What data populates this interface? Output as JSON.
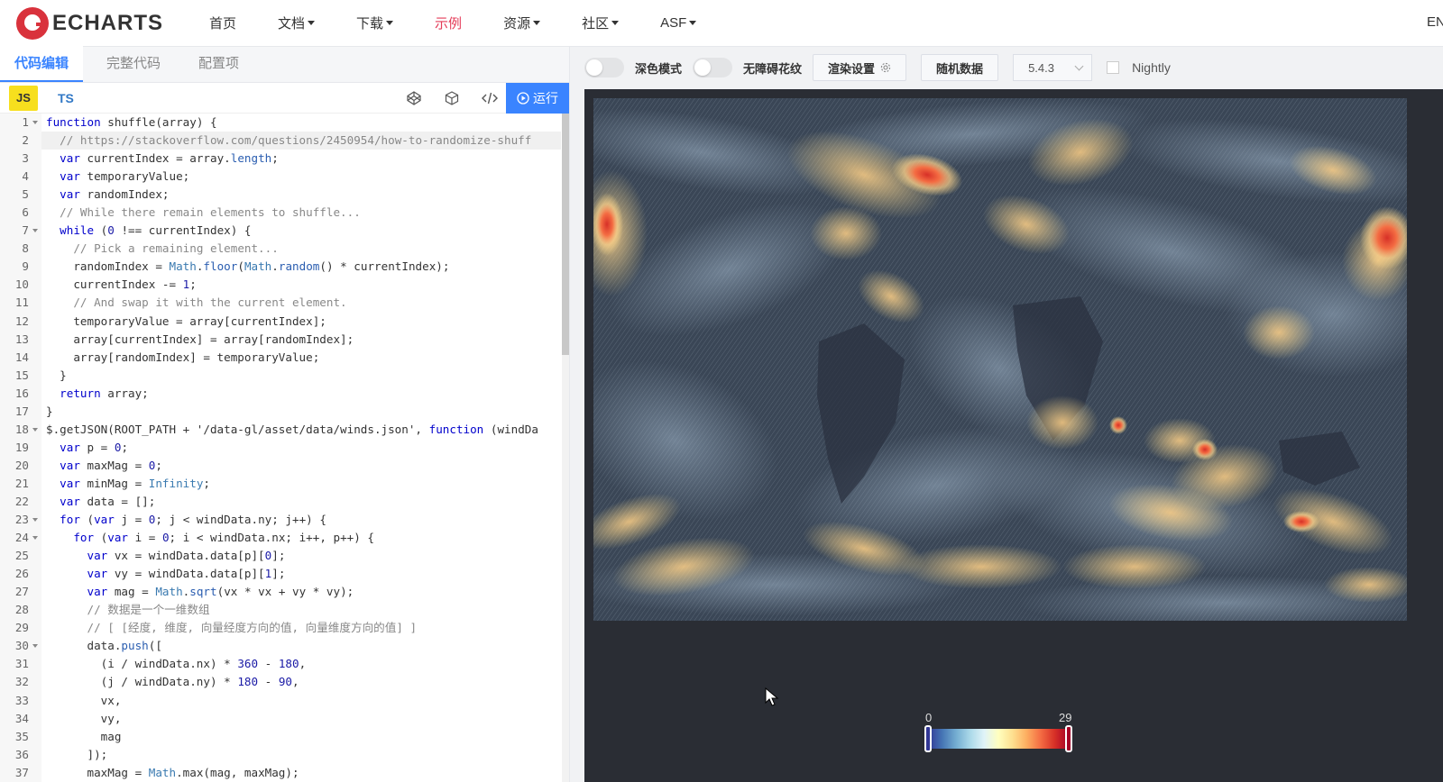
{
  "nav": {
    "logo_text": "ECHARTS",
    "items": [
      {
        "label": "首页",
        "dropdown": false,
        "active": false
      },
      {
        "label": "文档",
        "dropdown": true,
        "active": false
      },
      {
        "label": "下载",
        "dropdown": true,
        "active": false
      },
      {
        "label": "示例",
        "dropdown": false,
        "active": true
      },
      {
        "label": "资源",
        "dropdown": true,
        "active": false
      },
      {
        "label": "社区",
        "dropdown": true,
        "active": false
      },
      {
        "label": "ASF",
        "dropdown": true,
        "active": false
      }
    ],
    "lang": "EN",
    "active_color": "#e43c59"
  },
  "editor": {
    "tabs": [
      "代码编辑",
      "完整代码",
      "配置项"
    ],
    "active_tab": 0,
    "lang_js": "JS",
    "lang_ts": "TS",
    "tool_icons": [
      "codepen-icon",
      "codesandbox-icon",
      "code-icon"
    ],
    "run_label": "运行",
    "accent": "#3a84ff",
    "current_line": 2,
    "lines": [
      {
        "n": "1",
        "fold": true,
        "code": "function shuffle(array) {"
      },
      {
        "n": "2",
        "fold": false,
        "code": "  // https://stackoverflow.com/questions/2450954/how-to-randomize-shuff"
      },
      {
        "n": "3",
        "fold": false,
        "code": "  var currentIndex = array.length;"
      },
      {
        "n": "4",
        "fold": false,
        "code": "  var temporaryValue;"
      },
      {
        "n": "5",
        "fold": false,
        "code": "  var randomIndex;"
      },
      {
        "n": "6",
        "fold": false,
        "code": "  // While there remain elements to shuffle..."
      },
      {
        "n": "7",
        "fold": true,
        "code": "  while (0 !== currentIndex) {"
      },
      {
        "n": "8",
        "fold": false,
        "code": "    // Pick a remaining element..."
      },
      {
        "n": "9",
        "fold": false,
        "code": "    randomIndex = Math.floor(Math.random() * currentIndex);"
      },
      {
        "n": "10",
        "fold": false,
        "code": "    currentIndex -= 1;"
      },
      {
        "n": "11",
        "fold": false,
        "code": "    // And swap it with the current element."
      },
      {
        "n": "12",
        "fold": false,
        "code": "    temporaryValue = array[currentIndex];"
      },
      {
        "n": "13",
        "fold": false,
        "code": "    array[currentIndex] = array[randomIndex];"
      },
      {
        "n": "14",
        "fold": false,
        "code": "    array[randomIndex] = temporaryValue;"
      },
      {
        "n": "15",
        "fold": false,
        "code": "  }"
      },
      {
        "n": "16",
        "fold": false,
        "code": "  return array;"
      },
      {
        "n": "17",
        "fold": false,
        "code": "}"
      },
      {
        "n": "18",
        "fold": true,
        "code": "$.getJSON(ROOT_PATH + '/data-gl/asset/data/winds.json', function (windDa"
      },
      {
        "n": "19",
        "fold": false,
        "code": "  var p = 0;"
      },
      {
        "n": "20",
        "fold": false,
        "code": "  var maxMag = 0;"
      },
      {
        "n": "21",
        "fold": false,
        "code": "  var minMag = Infinity;"
      },
      {
        "n": "22",
        "fold": false,
        "code": "  var data = [];"
      },
      {
        "n": "23",
        "fold": true,
        "code": "  for (var j = 0; j < windData.ny; j++) {"
      },
      {
        "n": "24",
        "fold": true,
        "code": "    for (var i = 0; i < windData.nx; i++, p++) {"
      },
      {
        "n": "25",
        "fold": false,
        "code": "      var vx = windData.data[p][0];"
      },
      {
        "n": "26",
        "fold": false,
        "code": "      var vy = windData.data[p][1];"
      },
      {
        "n": "27",
        "fold": false,
        "code": "      var mag = Math.sqrt(vx * vx + vy * vy);"
      },
      {
        "n": "28",
        "fold": false,
        "code": "      // 数据是一个一维数组"
      },
      {
        "n": "29",
        "fold": false,
        "code": "      // [ [经度, 维度, 向量经度方向的值, 向量维度方向的值] ]"
      },
      {
        "n": "30",
        "fold": true,
        "code": "      data.push(["
      },
      {
        "n": "31",
        "fold": false,
        "code": "        (i / windData.nx) * 360 - 180,"
      },
      {
        "n": "32",
        "fold": false,
        "code": "        (j / windData.ny) * 180 - 90,"
      },
      {
        "n": "33",
        "fold": false,
        "code": "        vx,"
      },
      {
        "n": "34",
        "fold": false,
        "code": "        vy,"
      },
      {
        "n": "35",
        "fold": false,
        "code": "        mag"
      },
      {
        "n": "36",
        "fold": false,
        "code": "      ]);"
      },
      {
        "n": "37",
        "fold": false,
        "code": "      maxMag = Math.max(mag, maxMag);"
      }
    ]
  },
  "preview": {
    "dark_mode_label": "深色模式",
    "aria_label": "无障碍花纹",
    "render_settings_label": "渲染设置",
    "random_data_label": "随机数据",
    "version": "5.4.3",
    "nightly_label": "Nightly",
    "chart_bg": "#2a2d34",
    "visual_map": {
      "min": "0",
      "max": "29",
      "colors": [
        "#313695",
        "#4575b4",
        "#74add1",
        "#abd9e9",
        "#e0f3f8",
        "#ffffbf",
        "#fee090",
        "#fdae61",
        "#f46d43",
        "#d73027",
        "#a50026"
      ]
    }
  }
}
